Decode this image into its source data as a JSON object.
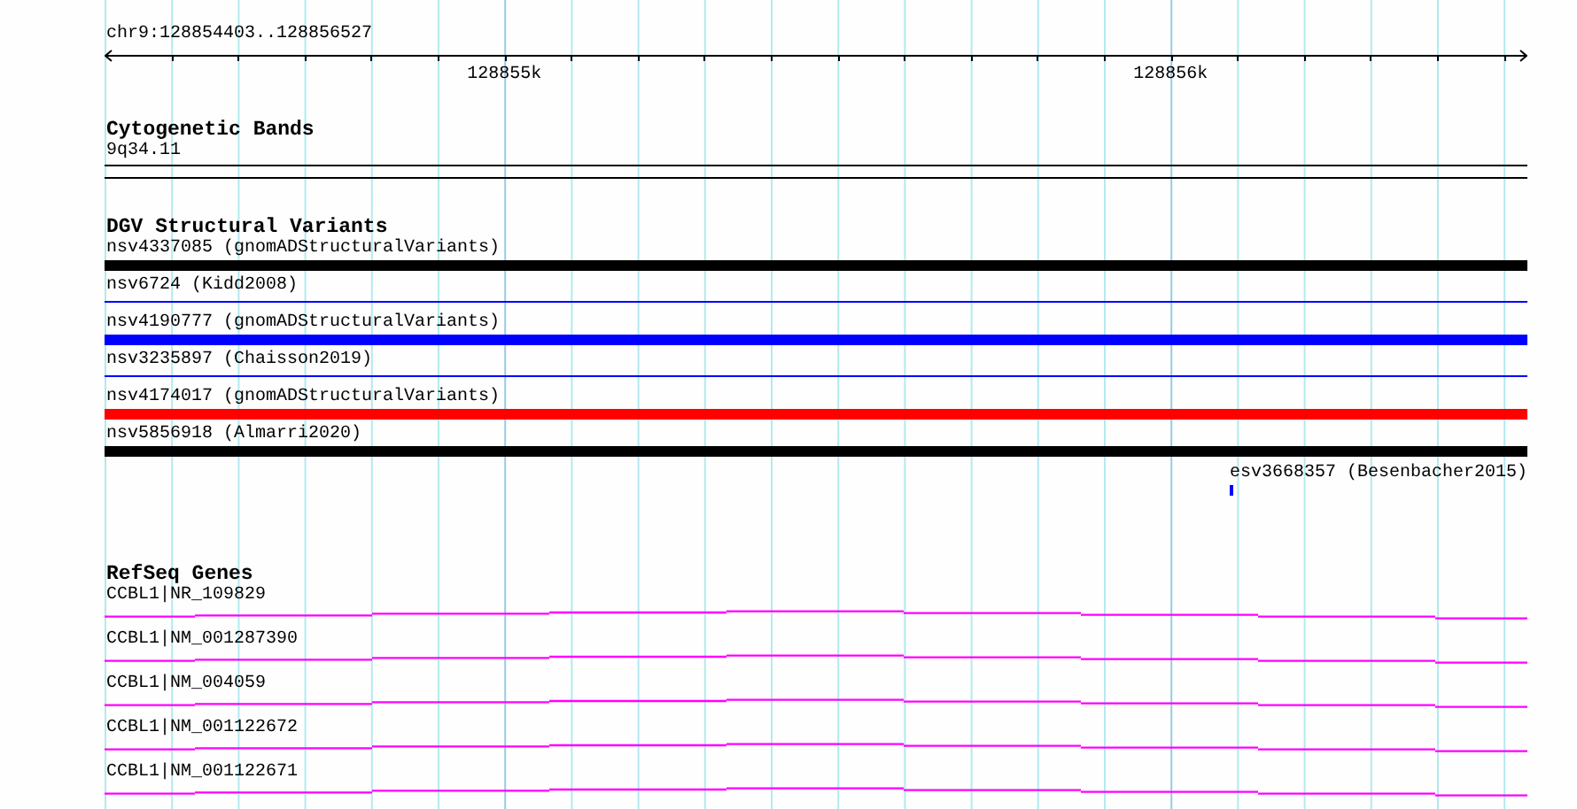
{
  "ruler": {
    "region": "chr9:128854403..128856527",
    "tick_labels": [
      "128855k",
      "128856k"
    ]
  },
  "cytogenetic_bands": {
    "title": "Cytogenetic Bands",
    "bands": [
      {
        "label": "9q34.11"
      }
    ]
  },
  "dgv": {
    "title": "DGV Structural Variants",
    "variants": [
      {
        "label": "nsv4337085 (gnomADStructuralVariants)",
        "kind": "bar",
        "color": "#000000"
      },
      {
        "label": "nsv6724 (Kidd2008)",
        "kind": "line",
        "color": "#0000ff"
      },
      {
        "label": "nsv4190777 (gnomADStructuralVariants)",
        "kind": "bar",
        "color": "#0000ff"
      },
      {
        "label": "nsv3235897 (Chaisson2019)",
        "kind": "line",
        "color": "#0000ff"
      },
      {
        "label": "nsv4174017 (gnomADStructuralVariants)",
        "kind": "bar",
        "color": "#ff0000"
      },
      {
        "label": "nsv5856918 (Almarri2020)",
        "kind": "bar",
        "color": "#000000"
      },
      {
        "label": "esv3668357 (Besenbacher2015)",
        "kind": "tick",
        "color": "#0000ff"
      }
    ]
  },
  "refseq": {
    "title": "RefSeq Genes",
    "genes": [
      {
        "label": "CCBL1|NR_109829"
      },
      {
        "label": "CCBL1|NM_001287390"
      },
      {
        "label": "CCBL1|NM_004059"
      },
      {
        "label": "CCBL1|NM_001122672"
      },
      {
        "label": "CCBL1|NM_001122671"
      }
    ]
  }
}
